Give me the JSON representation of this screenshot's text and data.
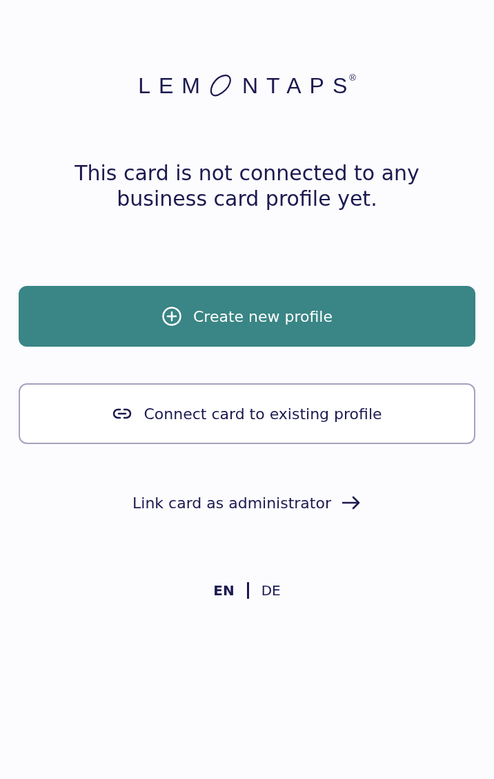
{
  "logo": {
    "before": "LEM",
    "after": "NTAPS",
    "mark": "®"
  },
  "message": "This card is not connected to any business card profile yet.",
  "actions": [
    {
      "kind": "primary",
      "label": "Create new profile"
    },
    {
      "kind": "secondary",
      "label": "Connect card to existing profile"
    }
  ],
  "admin_link": {
    "label": "Link card as administrator"
  },
  "languages": [
    {
      "label": "EN",
      "selected": true
    },
    {
      "label": "DE",
      "selected": false
    }
  ]
}
